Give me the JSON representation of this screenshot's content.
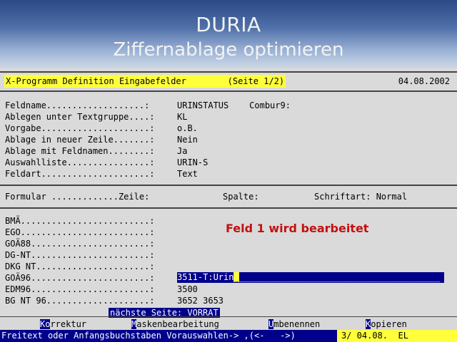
{
  "banner": {
    "title": "DURIA",
    "subtitle": "Ziffernablage optimieren"
  },
  "header": {
    "title": "X-Programm Definition Eingabefelder        (Seite 1/2)",
    "date": "04.08.2002"
  },
  "definition": {
    "rows": [
      {
        "label": "Feldname...................:",
        "value": "URINSTATUS    Combur9:"
      },
      {
        "label": "Ablegen unter Textgruppe....:",
        "value": "KL"
      },
      {
        "label": "Vorgabe.....................:",
        "value": "o.B."
      },
      {
        "label": "Ablage in neuer Zeile.......:",
        "value": "Nein"
      },
      {
        "label": "Ablage mit Feldnamen........:",
        "value": "Ja"
      },
      {
        "label": "Auswahlliste................:",
        "value": "URIN-S"
      },
      {
        "label": "Feldart.....................:",
        "value": "Text"
      }
    ]
  },
  "formular": {
    "label": "Formular .............Zeile:",
    "spalte": "Spalte:",
    "schriftart": "Schriftart: Normal"
  },
  "message": "Feld 1 wird bearbeitet",
  "fields": {
    "rows": [
      {
        "label": "BMÄ.........................:",
        "value": ""
      },
      {
        "label": "EGO.........................:",
        "value": ""
      },
      {
        "label": "GOÄ88.......................:",
        "value": ""
      },
      {
        "label": "DG-NT.......................:",
        "value": ""
      },
      {
        "label": "DKG NT......................:",
        "value": ""
      },
      {
        "label": "GOÄ96.......................:",
        "value": ""
      },
      {
        "label": "EDM96.......................:",
        "value": "3500"
      },
      {
        "label": "BG NT 96....................:",
        "value": "3652 3653"
      }
    ],
    "active_input": {
      "typed": "3511-T:Urin",
      "cursor": "_",
      "fill": "_______________________________________"
    }
  },
  "next_page": "nächste Seite: VORRAT",
  "footer": {
    "keys": [
      {
        "hotkey": "Ko",
        "rest": "rrektur"
      },
      {
        "hotkey": "M",
        "rest": "askenbearbeitung"
      },
      {
        "hotkey": "U",
        "rest": "mbenennen"
      },
      {
        "hotkey": "K",
        "rest": "opieren"
      }
    ]
  },
  "bottom": {
    "prompt": "Freitext oder Anfangsbuchstaben Vorauswahlen-> ,(<-   ->)",
    "status": "3/ 04.08.  EL"
  },
  "colors": {
    "background": "#dadada",
    "highlight_yellow": "#ffff3c",
    "navy": "#00008b",
    "message_red": "#c41010"
  }
}
